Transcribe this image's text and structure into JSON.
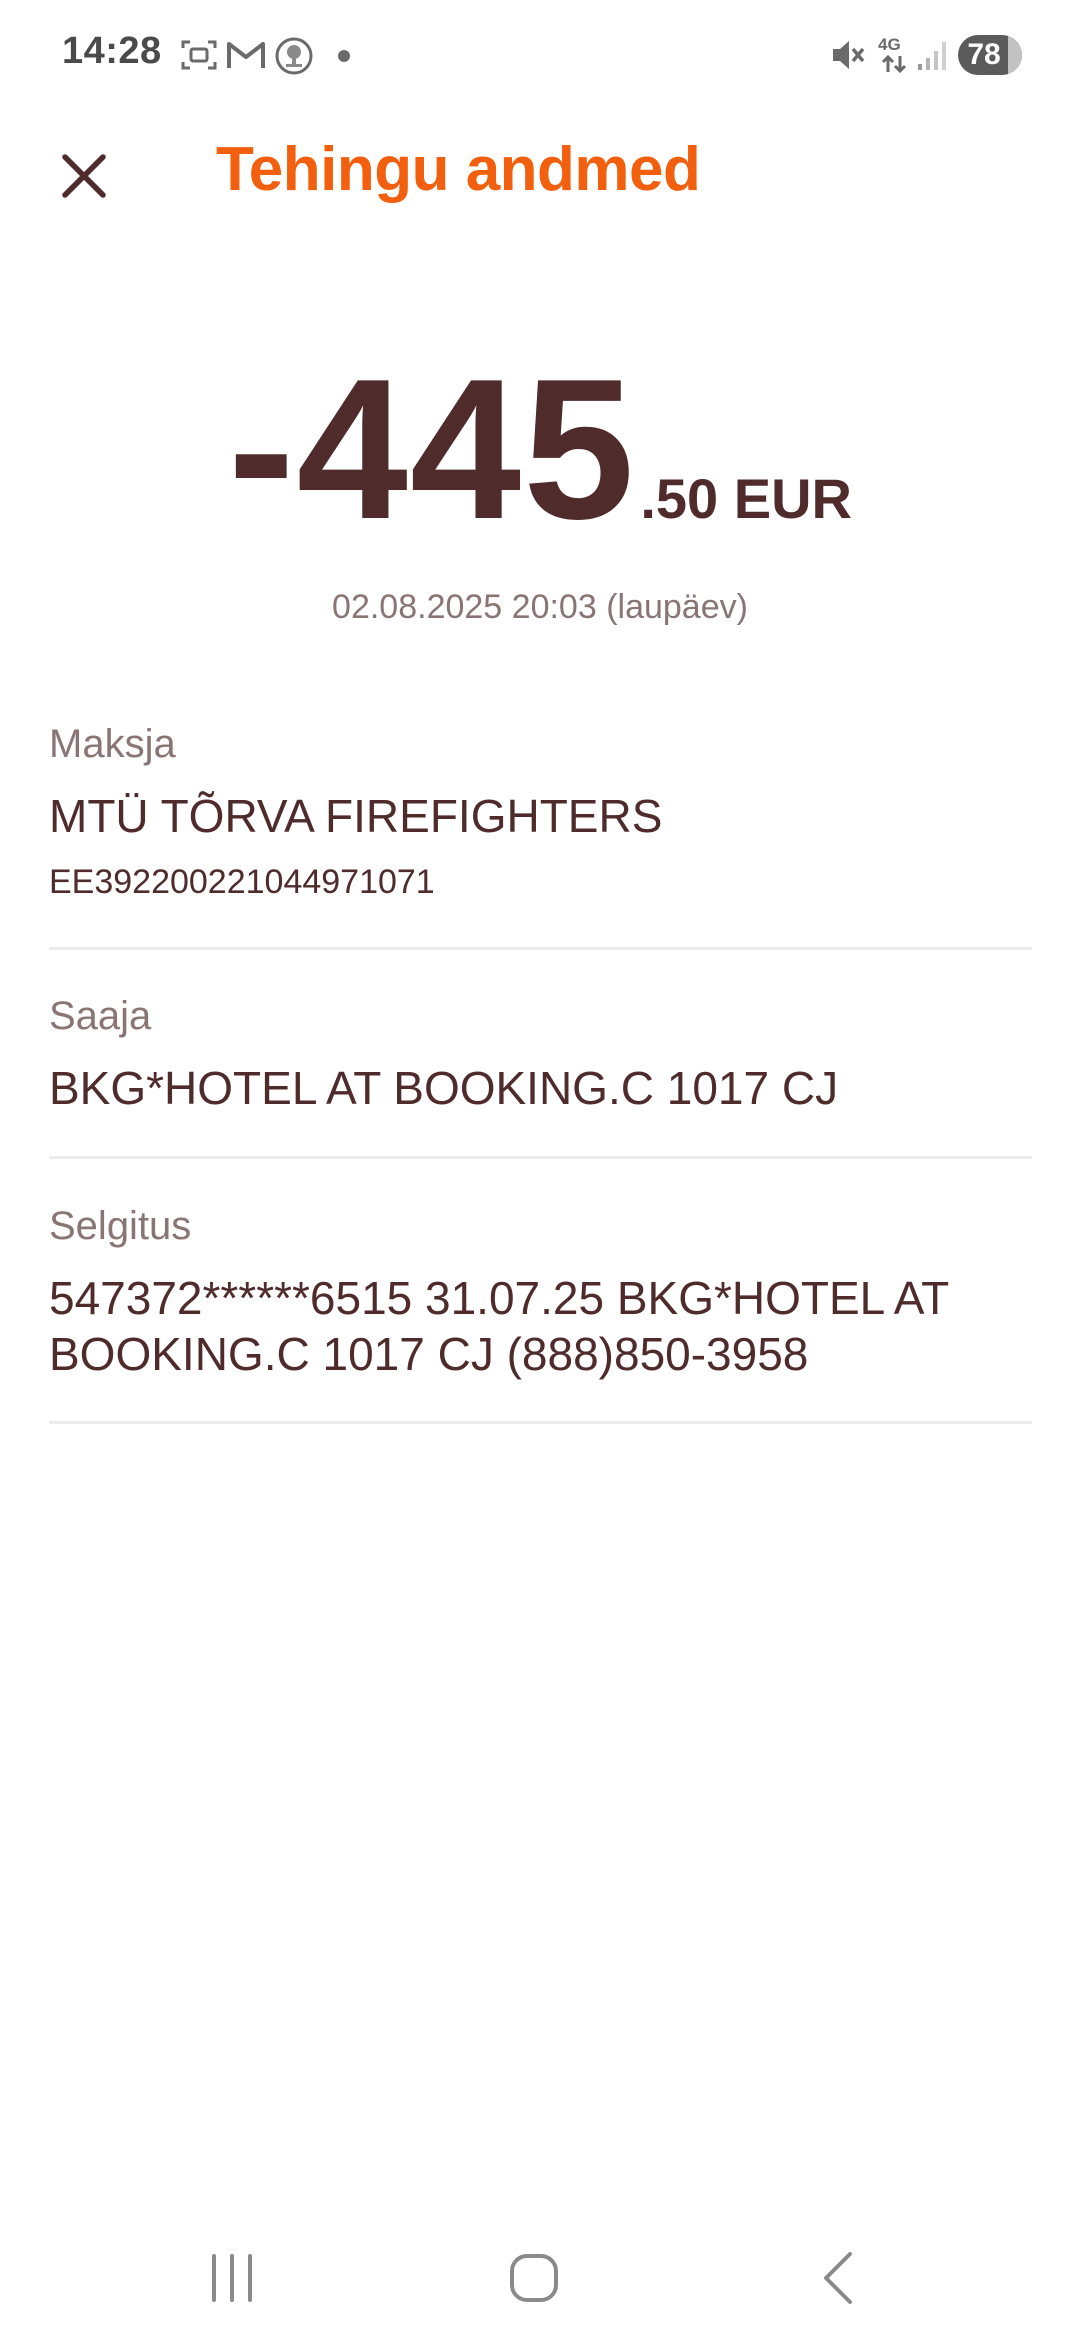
{
  "status_bar": {
    "time": "14:28",
    "battery": "78",
    "icons": [
      "screenshot-icon",
      "gmail-icon",
      "app-badge-icon",
      "notification-dot",
      "mute-icon",
      "4g-icon",
      "signal-icon",
      "battery-icon"
    ],
    "network_label": "4G"
  },
  "header": {
    "title": "Tehingu andmed",
    "close_icon": "close-icon"
  },
  "transaction": {
    "amount_main": "-445",
    "amount_decimal": ".50 EUR",
    "date": "02.08.2025 20:03 (laupäev)"
  },
  "payer": {
    "label": "Maksja",
    "name": "MTÜ TÕRVA FIREFIGHTERS",
    "iban": "EE392200221044971071"
  },
  "recipient": {
    "label": "Saaja",
    "name": "BKG*HOTEL AT BOOKING.C 1017 CJ"
  },
  "description": {
    "label": "Selgitus",
    "line1": "547372******6515 31.07.25  BKG*HOTEL AT",
    "line2": "BOOKING.C 1017 CJ (888)850-3958"
  },
  "nav_bar": {
    "icons": [
      "recent-apps-icon",
      "home-icon",
      "back-icon"
    ]
  },
  "colors": {
    "accent": "#f2600f",
    "text_primary": "#4f2b2b",
    "text_secondary": "#8a7575",
    "divider": "#ececec",
    "background": "#ffffff"
  }
}
